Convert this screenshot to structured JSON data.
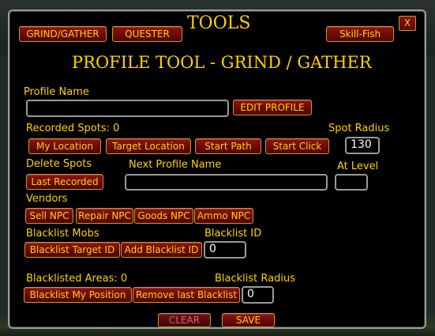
{
  "header": {
    "tools_title": "TOOLS",
    "grind_gather_tab": "GRIND/GATHER",
    "quester_tab": "QUESTER",
    "skill_fish_tab": "Skill-Fish",
    "close_label": "X"
  },
  "panel": {
    "title": "PROFILE TOOL - GRIND / GATHER",
    "profile_name_label": "Profile Name",
    "profile_name_value": "",
    "edit_profile_label": "EDIT PROFILE",
    "recorded_spots_label": "Recorded Spots: 0",
    "spot_radius_label": "Spot Radius",
    "spot_radius_value": "130",
    "my_location_label": "My Location",
    "target_location_label": "Target Location",
    "start_path_label": "Start Path",
    "start_click_label": "Start Click",
    "delete_spots_label": "Delete Spots",
    "last_recorded_label": "Last Recorded",
    "next_profile_name_label": "Next Profile Name",
    "next_profile_name_value": "",
    "at_level_label": "At Level",
    "at_level_value": "",
    "vendors_label": "Vendors",
    "sell_npc_label": "Sell NPC",
    "repair_npc_label": "Repair NPC",
    "goods_npc_label": "Goods NPC",
    "ammo_npc_label": "Ammo NPC",
    "blacklist_mobs_label": "Blacklist Mobs",
    "blacklist_id_label": "Blacklist ID",
    "blacklist_target_id_label": "Blacklist Target ID",
    "add_blacklist_id_label": "Add Blacklist ID",
    "blacklist_id_value": "0",
    "blacklisted_areas_label": "Blacklisted Areas: 0",
    "blacklist_radius_label": "Blacklist Radius",
    "blacklist_my_position_label": "Blacklist My Position",
    "remove_last_blacklist_label": "Remove last Blacklist",
    "blacklist_radius_value": "0",
    "clear_label": "CLEAR",
    "save_label": "SAVE"
  },
  "colors": {
    "text_gold": "#ffd100",
    "button_red": "#8e1414",
    "border_gold": "#c99a2e",
    "frame_grey": "#9b9b9b"
  }
}
